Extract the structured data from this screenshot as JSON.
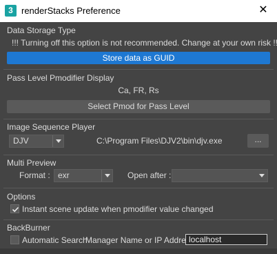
{
  "window": {
    "title": "renderStacks Preference",
    "icon_label": "3",
    "close_glyph": "✕"
  },
  "data_storage": {
    "title": "Data Storage Type",
    "warning": "!!! Turning off this option is not recommended. Change at your own risk !!!",
    "button_label": "Store data as GUID"
  },
  "pass_level": {
    "title": "Pass Level Pmodifier Display",
    "value": "Ca, FR, Rs",
    "button_label": "Select Pmod for Pass Level"
  },
  "image_player": {
    "title": "Image Sequence Player",
    "player_value": "DJV",
    "path": "C:\\Program Files\\DJV2\\bin\\djv.exe",
    "browse_label": "..."
  },
  "multi_preview": {
    "title": "Multi Preview",
    "format_label": "Format :",
    "format_value": "exr",
    "open_after_label": "Open after :",
    "open_after_value": ""
  },
  "options": {
    "title": "Options",
    "instant_update_label": "Instant scene update when pmodifier value changed",
    "instant_update_checked": true
  },
  "backburner": {
    "title": "BackBurner",
    "auto_search_label": "Automatic Search",
    "auto_search_checked": false,
    "manager_label": "Manager Name or IP Address",
    "manager_value": "localhost"
  },
  "colors": {
    "background": "#444444",
    "accent_button": "#1e78d2",
    "title_bar": "#ffffff",
    "app_icon": "#1aa3a3"
  }
}
